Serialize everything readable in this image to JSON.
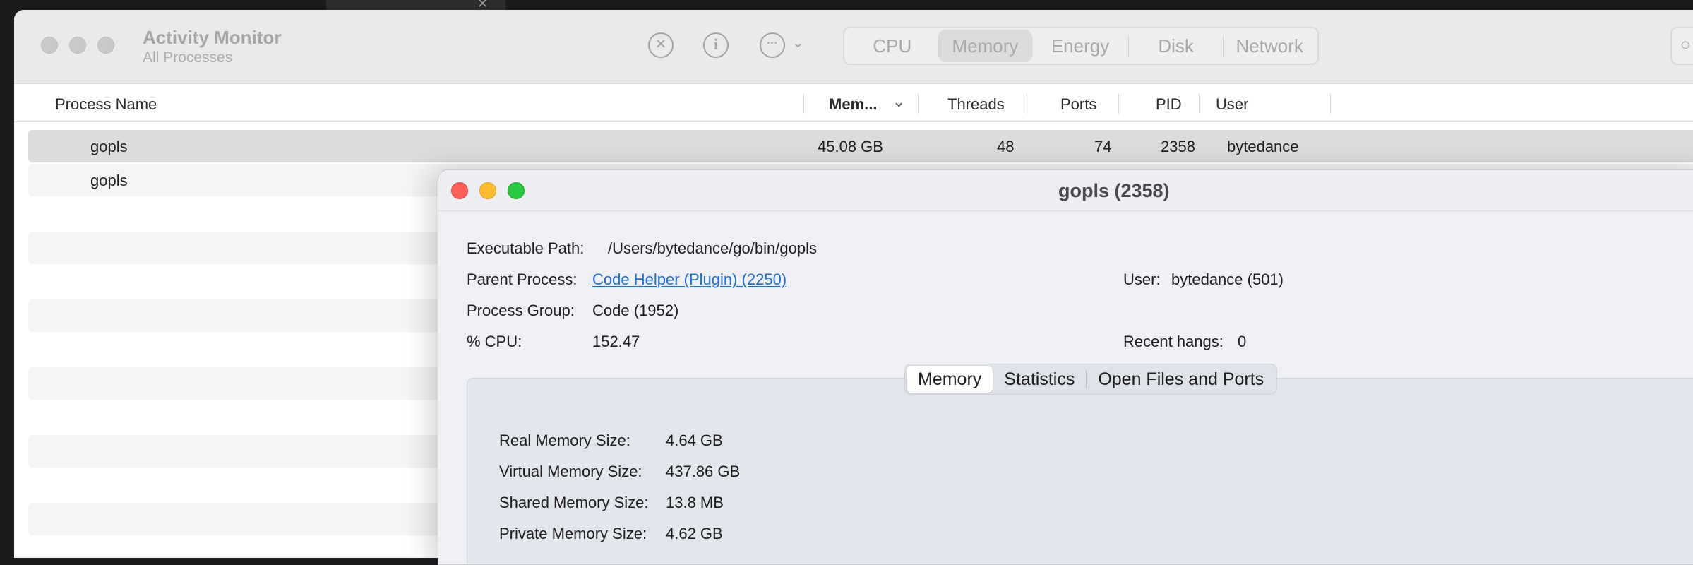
{
  "background": {
    "tab_close": "✕"
  },
  "app": {
    "title": "Activity Monitor",
    "subtitle": "All Processes",
    "toolbar": {
      "stop_icon": "✕",
      "info_icon": "i",
      "more_icon": "···",
      "chevron": "⌄"
    },
    "tabs": [
      {
        "label": "CPU",
        "selected": false
      },
      {
        "label": "Memory",
        "selected": true
      },
      {
        "label": "Energy",
        "selected": false
      },
      {
        "label": "Disk",
        "selected": false
      },
      {
        "label": "Network",
        "selected": false
      }
    ]
  },
  "table": {
    "columns": {
      "process_name": "Process Name",
      "memory": "Mem...",
      "memory_sort": "⌄",
      "threads": "Threads",
      "ports": "Ports",
      "pid": "PID",
      "user": "User"
    },
    "rows": [
      {
        "name": "gopls",
        "memory": "45.08 GB",
        "threads": "48",
        "ports": "74",
        "pid": "2358",
        "user": "bytedance"
      },
      {
        "name": "gopls",
        "memory": "",
        "threads": "",
        "ports": "",
        "pid": "",
        "user": ""
      }
    ]
  },
  "inspector": {
    "title": "gopls (2358)",
    "executable_path_label": "Executable Path:",
    "executable_path": "/Users/bytedance/go/bin/gopls",
    "parent_process_label": "Parent Process:",
    "parent_process": "Code Helper (Plugin) (2250)",
    "user_label": "User:",
    "user": "bytedance (501)",
    "process_group_label": "Process Group:",
    "process_group": "Code (1952)",
    "cpu_label": "% CPU:",
    "cpu": "152.47",
    "recent_hangs_label": "Recent hangs:",
    "recent_hangs": "0",
    "tabs": [
      "Memory",
      "Statistics",
      "Open Files and Ports"
    ],
    "memory": {
      "real_label": "Real Memory Size:",
      "real": "4.64 GB",
      "virtual_label": "Virtual Memory Size:",
      "virtual": "437.86 GB",
      "shared_label": "Shared Memory Size:",
      "shared": "13.8 MB",
      "private_label": "Private Memory Size:",
      "private": "4.62 GB"
    }
  }
}
